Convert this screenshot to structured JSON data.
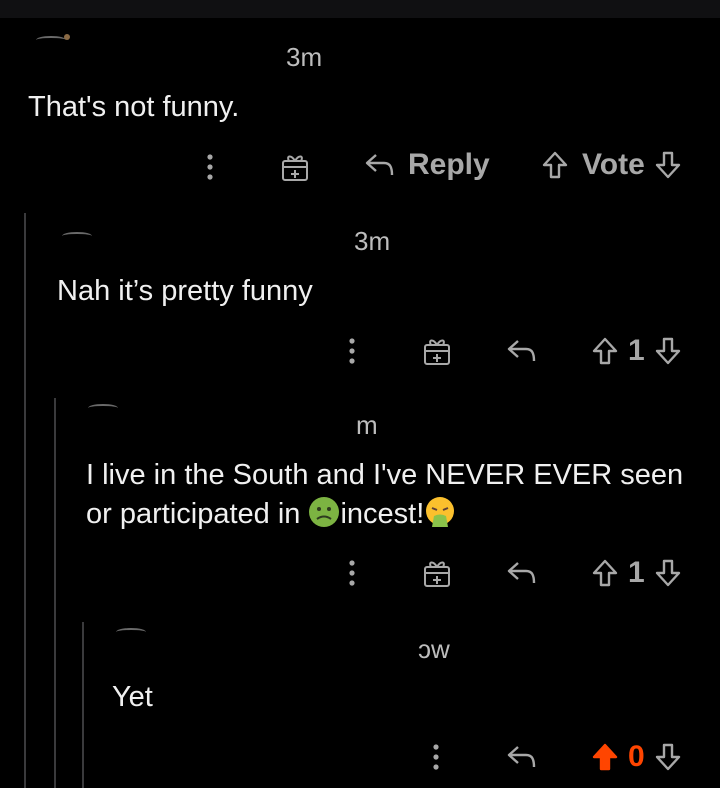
{
  "comments": [
    {
      "time": "3m",
      "text": "That's not funny.",
      "reply_label": "Reply",
      "vote_label": "Vote"
    },
    {
      "time": "3m",
      "text": "Nah it’s pretty funny",
      "score": "1"
    },
    {
      "time": "m",
      "text_parts": [
        "I live in the South and I've NEVER EVER seen or participated in ",
        "incest!"
      ],
      "emojis": [
        "nauseated-face",
        "vomiting-face"
      ],
      "score": "1"
    },
    {
      "time": "ɔw",
      "text": "Yet",
      "score": "0",
      "upvoted": true
    }
  ],
  "colors": {
    "background": "#000000",
    "text": "#f0f0f0",
    "muted": "#a8a8a8",
    "upvote": "#ff4500"
  }
}
